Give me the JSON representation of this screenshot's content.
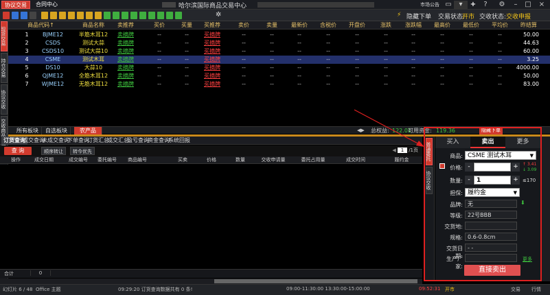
{
  "window": {
    "active_tab": "协议交易",
    "contract_tab": "合同中心",
    "title": "哈尔滨国际商品交易中心",
    "market_notice": "市场公告"
  },
  "toolbar": {
    "hide_order": "隐藏下单",
    "trade_status_label": "交易状态:",
    "trade_status": "开市",
    "exchange_status_label": "交收状态:",
    "exchange_status": "交收申报"
  },
  "left_tabs": [
    "现货交易",
    "持仓交易",
    "协议交收",
    "交收商品维护"
  ],
  "grid": {
    "headers": [
      "商品代码↑",
      "商品名称",
      "卖推荐",
      "买价",
      "买量",
      "买推荐",
      "卖价",
      "卖量",
      "最新价",
      "含税价",
      "开盘价",
      "涨跌",
      "涨跌幅",
      "最高价",
      "最低价",
      "平均价",
      "昨结算"
    ],
    "rows": [
      {
        "idx": "1",
        "code": "BJME12",
        "name": "半筋木耳12",
        "sell": "卖摘牌",
        "bid": "--",
        "bidqty": "--",
        "buy": "买摘牌",
        "ask": "--",
        "askqty": "--",
        "last": "--",
        "tax": "--",
        "open": "--",
        "chg": "--",
        "chgp": "--",
        "high": "--",
        "low": "--",
        "avg": "--",
        "settle": "50.00"
      },
      {
        "idx": "2",
        "code": "CSDS",
        "name": "测试大蒜",
        "sell": "卖摘牌",
        "bid": "--",
        "bidqty": "--",
        "buy": "买摘牌",
        "ask": "--",
        "askqty": "--",
        "last": "--",
        "tax": "--",
        "open": "--",
        "chg": "--",
        "chgp": "--",
        "high": "--",
        "low": "--",
        "avg": "--",
        "settle": "44.63"
      },
      {
        "idx": "3",
        "code": "CSDS10",
        "name": "测试大蒜10",
        "sell": "卖摘牌",
        "bid": "--",
        "bidqty": "--",
        "buy": "买摘牌",
        "ask": "--",
        "askqty": "--",
        "last": "--",
        "tax": "--",
        "open": "--",
        "chg": "--",
        "chgp": "--",
        "high": "--",
        "low": "--",
        "avg": "--",
        "settle": "60.00"
      },
      {
        "idx": "4",
        "code": "CSME",
        "name": "测试木耳",
        "sell": "卖摘牌",
        "bid": "--",
        "bidqty": "--",
        "buy": "买摘牌",
        "ask": "--",
        "askqty": "--",
        "last": "--",
        "tax": "--",
        "open": "--",
        "chg": "--",
        "chgp": "--",
        "high": "--",
        "low": "--",
        "avg": "--",
        "settle": "3.25"
      },
      {
        "idx": "5",
        "code": "DS10",
        "name": "大蒜10",
        "sell": "卖摘牌",
        "bid": "--",
        "bidqty": "--",
        "buy": "买摘牌",
        "ask": "--",
        "askqty": "--",
        "last": "--",
        "tax": "--",
        "open": "--",
        "chg": "--",
        "chgp": "--",
        "high": "--",
        "low": "--",
        "avg": "--",
        "settle": "4000.00"
      },
      {
        "idx": "6",
        "code": "QJME12",
        "name": "全筋木耳12",
        "sell": "卖摘牌",
        "bid": "--",
        "bidqty": "--",
        "buy": "买摘牌",
        "ask": "--",
        "askqty": "--",
        "last": "--",
        "tax": "--",
        "open": "--",
        "chg": "--",
        "chgp": "--",
        "high": "--",
        "low": "--",
        "avg": "--",
        "settle": "50.00"
      },
      {
        "idx": "7",
        "code": "WJME12",
        "name": "无筋木耳12",
        "sell": "卖摘牌",
        "bid": "--",
        "bidqty": "--",
        "buy": "买摘牌",
        "ask": "--",
        "askqty": "--",
        "last": "--",
        "tax": "--",
        "open": "--",
        "chg": "--",
        "chgp": "--",
        "high": "--",
        "low": "--",
        "avg": "--",
        "settle": "83.00"
      }
    ]
  },
  "section_tabs": [
    "所有板块",
    "自选板块",
    "农产品"
  ],
  "summary": {
    "equity_label": "总权益:",
    "equity": "122.01",
    "available_label": "可用资金:",
    "available": "119.36",
    "hide_order": "隐藏下单"
  },
  "query_tabs": [
    "订货查询",
    "成交查询",
    "未成交查询",
    "下单查询",
    "订货汇总",
    "成交汇总",
    "盈亏查询",
    "资金查询",
    "系统回报"
  ],
  "query_tools": {
    "query": "查 询",
    "seq_transfer": "顺序转让",
    "transfer_first": "转今优先",
    "page": "1",
    "page_total": "/1页"
  },
  "query_headers": [
    "操作",
    "成交日期",
    "成交编号",
    "委托编号",
    "商品编号",
    "买卖",
    "价格",
    "数量",
    "交收申请量",
    "委托占用量",
    "成交时间",
    "履约金"
  ],
  "query_footer": {
    "total_label": "合计",
    "total": "0"
  },
  "trade_side_tabs": [
    "普通委托",
    "协议交收"
  ],
  "trade": {
    "tabs": [
      "买入",
      "卖出",
      "更多"
    ],
    "product_label": "商品:",
    "product": "CSME 测试木耳",
    "price_label": "价格:",
    "price_up": "3.41",
    "price_down": "3.09",
    "qty_label": "数量:",
    "qty": "1",
    "qty_max": "≤170",
    "margin_label": "担保:",
    "margin": "履约金",
    "brand_label": "品牌:",
    "brand": "无",
    "grade_label": "等级:",
    "grade": "22号BBB",
    "delivery_place_label": "交货地:",
    "delivery_place": "",
    "spec_label": "规格:",
    "spec": "0.6-0.8cm",
    "delivery_date_label": "交货日期:",
    "delivery_date": "- -",
    "maker_label": "生产厂家:",
    "maker": "",
    "more": "更多",
    "submit": "直接卖出"
  },
  "statusbar": {
    "slide": "幻灯片 6 / 48",
    "theme": "Office 主题",
    "message": "09:29:20 订货查询数据共有 0 条!",
    "session": "09:00-11:30:00  13:30:00-15:00:00",
    "clock": "09:52:31",
    "market": "开市",
    "right1": "交易",
    "right2": "行情"
  },
  "colors": {
    "accent": "#d13b2e",
    "buy": "#ff4040",
    "sell": "#3fc83f",
    "header": "#e8c36a"
  }
}
